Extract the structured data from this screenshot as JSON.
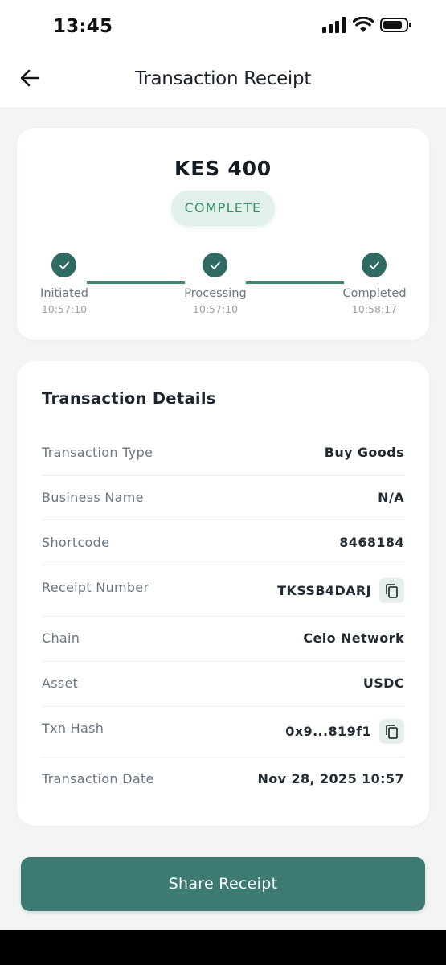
{
  "status_bar": {
    "time": "13:45"
  },
  "header": {
    "title": "Transaction Receipt",
    "back_icon": "arrow-left-icon"
  },
  "summary": {
    "amount": "KES 400",
    "status": "COMPLETE",
    "status_color": "#3d8d6b",
    "accent_color": "#2f6b62",
    "steps": [
      {
        "label": "Initiated",
        "time": "10:57:10",
        "done": true
      },
      {
        "label": "Processing",
        "time": "10:57:10",
        "done": true
      },
      {
        "label": "Completed",
        "time": "10:58:17",
        "done": true
      }
    ]
  },
  "details": {
    "title": "Transaction Details",
    "rows": [
      {
        "label": "Transaction Type",
        "value": "Buy Goods"
      },
      {
        "label": "Business Name",
        "value": "N/A"
      },
      {
        "label": "Shortcode",
        "value": "8468184"
      },
      {
        "label": "Receipt Number",
        "value": "TKSSB4DARJ",
        "copy": true
      },
      {
        "label": "Chain",
        "value": "Celo Network"
      },
      {
        "label": "Asset",
        "value": "USDC"
      },
      {
        "label": "Txn Hash",
        "value": "0x9...819f1",
        "copy": true
      },
      {
        "label": "Transaction Date",
        "value": "Nov 28, 2025 10:57"
      }
    ]
  },
  "actions": {
    "share_label": "Share Receipt",
    "button_color": "#3d7b72"
  }
}
